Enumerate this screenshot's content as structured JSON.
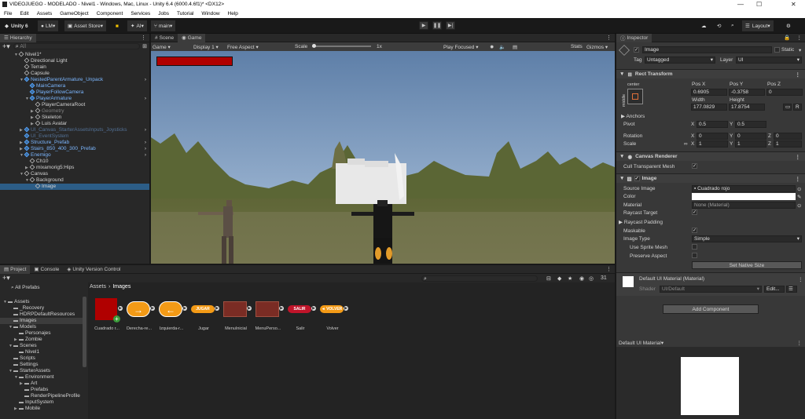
{
  "window": {
    "title": "VIDEOJUEGO - MODELADO - Nivel1 - Windows, Mac, Linux - Unity 6.4 (6000.4.6f1)* <DX12>"
  },
  "menu": [
    "File",
    "Edit",
    "Assets",
    "GameObject",
    "Component",
    "Services",
    "Jobs",
    "Tutorial",
    "Window",
    "Help"
  ],
  "toolbar": {
    "unity": "Unity 6",
    "account": "LM",
    "asset_store": "Asset Store",
    "ai": "AI",
    "branch": "main",
    "layout": "Layout"
  },
  "hierarchy": {
    "tab": "Hierarchy",
    "search_placeholder": "All",
    "items": [
      {
        "label": "Nivel1*",
        "indent": 0,
        "blue": false,
        "arrow": "▼"
      },
      {
        "label": "Directional Light",
        "indent": 1,
        "blue": false,
        "arrow": ""
      },
      {
        "label": "Terrain",
        "indent": 1,
        "blue": false,
        "arrow": ""
      },
      {
        "label": "Capsule",
        "indent": 1,
        "blue": false,
        "arrow": ""
      },
      {
        "label": "NestedParentArmature_Unpack",
        "indent": 1,
        "blue": true,
        "arrow": "▼"
      },
      {
        "label": "MainCamera",
        "indent": 2,
        "blue": true,
        "arrow": ""
      },
      {
        "label": "PlayerFollowCamera",
        "indent": 2,
        "blue": true,
        "arrow": ""
      },
      {
        "label": "PlayerArmature",
        "indent": 2,
        "blue": true,
        "arrow": "▼"
      },
      {
        "label": "PlayerCameraRoot",
        "indent": 3,
        "blue": false,
        "arrow": ""
      },
      {
        "label": "Geometry",
        "indent": 3,
        "blue": false,
        "arrow": "▶",
        "dim": true
      },
      {
        "label": "Skeleton",
        "indent": 3,
        "blue": false,
        "arrow": "▶"
      },
      {
        "label": "Luis Avatar",
        "indent": 3,
        "blue": false,
        "arrow": "▶"
      },
      {
        "label": "UI_Canvas_StarterAssetsInputs_Joysticks",
        "indent": 1,
        "blue": true,
        "arrow": "▶",
        "dim": true
      },
      {
        "label": "UI_EventSystem",
        "indent": 1,
        "blue": true,
        "arrow": "",
        "dim": true
      },
      {
        "label": "Structure_Prefab",
        "indent": 1,
        "blue": true,
        "arrow": "▶"
      },
      {
        "label": "Stairs_850_400_300_Prefab",
        "indent": 1,
        "blue": true,
        "arrow": "▶"
      },
      {
        "label": "Enemigo",
        "indent": 1,
        "blue": true,
        "arrow": "▼"
      },
      {
        "label": "Ch10",
        "indent": 2,
        "blue": false,
        "arrow": ""
      },
      {
        "label": "mixamorig5:Hips",
        "indent": 2,
        "blue": false,
        "arrow": "▶"
      },
      {
        "label": "Canvas",
        "indent": 1,
        "blue": false,
        "arrow": "▼"
      },
      {
        "label": "Background",
        "indent": 2,
        "blue": false,
        "arrow": "▼"
      },
      {
        "label": "Image",
        "indent": 3,
        "blue": false,
        "arrow": "",
        "selected": true
      }
    ]
  },
  "scene_tabs": {
    "scene": "Scene",
    "game": "Game"
  },
  "game_bar": {
    "mode": "Game",
    "display": "Display 1",
    "aspect": "Free Aspect",
    "scale_label": "Scale",
    "scale_value": "1x",
    "play_focused": "Play Focused",
    "stats": "Stats",
    "gizmos": "Gizmos"
  },
  "inspector": {
    "tab": "Inspector",
    "object_name": "Image",
    "static_label": "Static",
    "tag_label": "Tag",
    "tag_value": "Untagged",
    "layer_label": "Layer",
    "layer_value": "UI",
    "rect_transform": {
      "title": "Rect Transform",
      "anchor_h": "center",
      "anchor_v": "middle",
      "posx_label": "Pos X",
      "posy_label": "Pos Y",
      "posz_label": "Pos Z",
      "posx": "0.6905",
      "posy": "-0.3758",
      "posz": "0",
      "width_label": "Width",
      "height_label": "Height",
      "width": "177.0829",
      "height": "17.8754",
      "anchors": "Anchors",
      "pivot": "Pivot",
      "pivot_x": "0.5",
      "pivot_y": "0.5",
      "rotation": "Rotation",
      "rot_x": "0",
      "rot_y": "0",
      "rot_z": "0",
      "scale": "Scale",
      "scale_x": "1",
      "scale_y": "1",
      "scale_z": "1"
    },
    "canvas_renderer": {
      "title": "Canvas Renderer",
      "cull": "Cull Transparent Mesh"
    },
    "image": {
      "title": "Image",
      "source_label": "Source Image",
      "source_value": "Cuadrado rojo",
      "color_label": "Color",
      "material_label": "Material",
      "material_value": "None (Material)",
      "raycast_target": "Raycast Target",
      "raycast_padding": "Raycast Padding",
      "maskable": "Maskable",
      "image_type": "Image Type",
      "image_type_value": "Simple",
      "use_sprite_mesh": "Use Sprite Mesh",
      "preserve_aspect": "Preserve Aspect",
      "set_native": "Set Native Size"
    },
    "material": {
      "title": "Default UI Material (Material)",
      "shader_label": "Shader",
      "shader_value": "UI/Default",
      "edit": "Edit..."
    },
    "add_component": "Add Component",
    "preview_title": "Default UI Material"
  },
  "project": {
    "tabs": [
      "Project",
      "Console",
      "Unity Version Control"
    ],
    "favorites": "All Prefabs",
    "badge": "31",
    "breadcrumb": [
      "Assets",
      "Images"
    ],
    "tree": [
      {
        "label": "Assets",
        "indent": 0,
        "arrow": "▼"
      },
      {
        "label": "_Recovery",
        "indent": 1,
        "arrow": ""
      },
      {
        "label": "HDRPDefaultResources",
        "indent": 1,
        "arrow": ""
      },
      {
        "label": "Images",
        "indent": 1,
        "arrow": "",
        "selected": true
      },
      {
        "label": "Models",
        "indent": 1,
        "arrow": "▼"
      },
      {
        "label": "Personajes",
        "indent": 2,
        "arrow": ""
      },
      {
        "label": "Zombie",
        "indent": 2,
        "arrow": "▶"
      },
      {
        "label": "Scenes",
        "indent": 1,
        "arrow": "▼"
      },
      {
        "label": "Nivel1",
        "indent": 2,
        "arrow": ""
      },
      {
        "label": "Scripts",
        "indent": 1,
        "arrow": ""
      },
      {
        "label": "Settings",
        "indent": 1,
        "arrow": ""
      },
      {
        "label": "StarterAssets",
        "indent": 1,
        "arrow": "▼"
      },
      {
        "label": "Environment",
        "indent": 2,
        "arrow": "▼"
      },
      {
        "label": "Art",
        "indent": 3,
        "arrow": "▶"
      },
      {
        "label": "Prefabs",
        "indent": 3,
        "arrow": ""
      },
      {
        "label": "RenderPipelineProfile",
        "indent": 3,
        "arrow": ""
      },
      {
        "label": "InputSystem",
        "indent": 2,
        "arrow": ""
      },
      {
        "label": "Mobile",
        "indent": 2,
        "arrow": "▶"
      }
    ],
    "assets": [
      {
        "label": "Cuadrado r...",
        "kind": "square",
        "color": "#b00000",
        "text": ""
      },
      {
        "label": "Derecha-re...",
        "kind": "arrow",
        "color": "#f39a16",
        "text": "→"
      },
      {
        "label": "Izquierda-r...",
        "kind": "arrow",
        "color": "#f39a16",
        "text": "←"
      },
      {
        "label": "Jugar",
        "kind": "pill",
        "color": "#f39a16",
        "text": "JUGAR"
      },
      {
        "label": "MenuInicial",
        "kind": "panel",
        "color": "#7a2c24",
        "text": ""
      },
      {
        "label": "MenuPerso...",
        "kind": "panel",
        "color": "#7a2c24",
        "text": ""
      },
      {
        "label": "Salir",
        "kind": "pill",
        "color": "#c0142a",
        "text": "SALIR"
      },
      {
        "label": "Volver",
        "kind": "pill",
        "color": "#f39a16",
        "text": "◄ VOLVER"
      }
    ]
  },
  "colors": {
    "selection": "#2c5d87",
    "bg": "#383838",
    "hierarchy_bg": "#282828"
  }
}
